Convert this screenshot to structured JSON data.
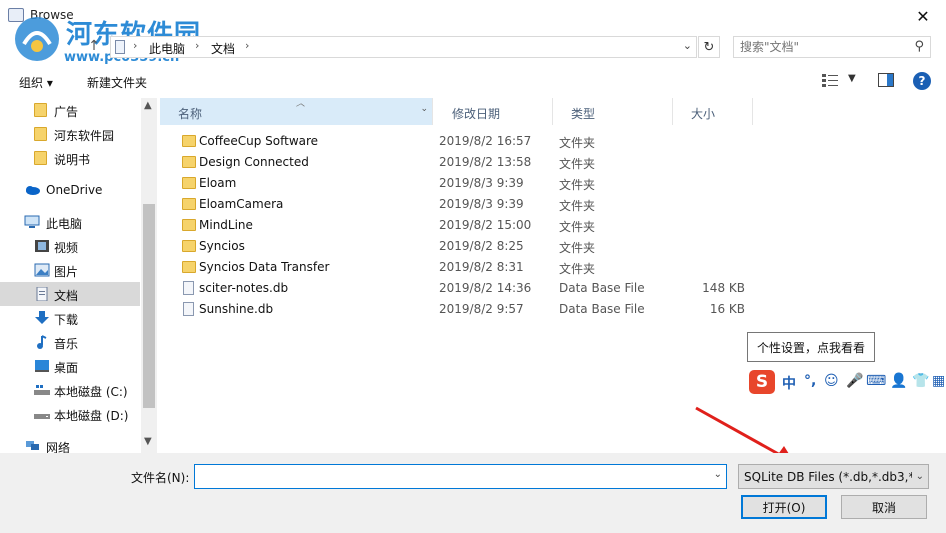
{
  "window": {
    "title": "Browse"
  },
  "watermark": {
    "cn": "河东软件园",
    "url": "www.pc0359.cn"
  },
  "address": {
    "segments": [
      "此电脑",
      "文档"
    ],
    "search_placeholder": "搜索\"文档\""
  },
  "toolbar": {
    "organize": "组织 ▾",
    "new_folder": "新建文件夹"
  },
  "nav": {
    "items": [
      {
        "label": "广告",
        "icon": "folder-icon"
      },
      {
        "label": "河东软件园",
        "icon": "folder-icon"
      },
      {
        "label": "说明书",
        "icon": "folder-icon"
      },
      {
        "label": "OneDrive",
        "icon": "cloud-icon"
      },
      {
        "label": "此电脑",
        "icon": "computer-icon"
      },
      {
        "label": "视频",
        "icon": "video-icon"
      },
      {
        "label": "图片",
        "icon": "picture-icon"
      },
      {
        "label": "文档",
        "icon": "document-icon"
      },
      {
        "label": "下载",
        "icon": "download-icon"
      },
      {
        "label": "音乐",
        "icon": "music-icon"
      },
      {
        "label": "桌面",
        "icon": "desktop-icon"
      },
      {
        "label": "本地磁盘 (C:)",
        "icon": "drive-icon"
      },
      {
        "label": "本地磁盘 (D:)",
        "icon": "drive-icon"
      },
      {
        "label": "网络",
        "icon": "network-icon"
      }
    ]
  },
  "columns": {
    "name": "名称",
    "date": "修改日期",
    "type": "类型",
    "size": "大小"
  },
  "files": [
    {
      "name": "CoffeeCup Software",
      "date": "2019/8/2 16:57",
      "type": "文件夹",
      "size": "",
      "kind": "folder"
    },
    {
      "name": "Design Connected",
      "date": "2019/8/2 13:58",
      "type": "文件夹",
      "size": "",
      "kind": "folder"
    },
    {
      "name": "Eloam",
      "date": "2019/8/3 9:39",
      "type": "文件夹",
      "size": "",
      "kind": "folder"
    },
    {
      "name": "EloamCamera",
      "date": "2019/8/3 9:39",
      "type": "文件夹",
      "size": "",
      "kind": "folder"
    },
    {
      "name": "MindLine",
      "date": "2019/8/2 15:00",
      "type": "文件夹",
      "size": "",
      "kind": "folder"
    },
    {
      "name": "Syncios",
      "date": "2019/8/2 8:25",
      "type": "文件夹",
      "size": "",
      "kind": "folder"
    },
    {
      "name": "Syncios Data Transfer",
      "date": "2019/8/2 8:31",
      "type": "文件夹",
      "size": "",
      "kind": "folder"
    },
    {
      "name": "sciter-notes.db",
      "date": "2019/8/2 14:36",
      "type": "Data Base File",
      "size": "148 KB",
      "kind": "file"
    },
    {
      "name": "Sunshine.db",
      "date": "2019/8/2 9:57",
      "type": "Data Base File",
      "size": "16 KB",
      "kind": "file"
    }
  ],
  "tooltip": "个性设置，点我看看",
  "ime": {
    "logo": "S",
    "items": [
      "中",
      "°,",
      "☺",
      "🎤",
      "⌨",
      "👤",
      "👕",
      "▦"
    ]
  },
  "bottom": {
    "filename_label": "文件名(N):",
    "filename_value": "",
    "filetype": "SQLite DB Files (*.db,*.db3,*.",
    "open": "打开(O)",
    "cancel": "取消"
  },
  "colors": {
    "accent": "#0078d7",
    "selected": "#d9d9d9",
    "header": "#d9ebf9",
    "arrow": "#e0201b"
  }
}
